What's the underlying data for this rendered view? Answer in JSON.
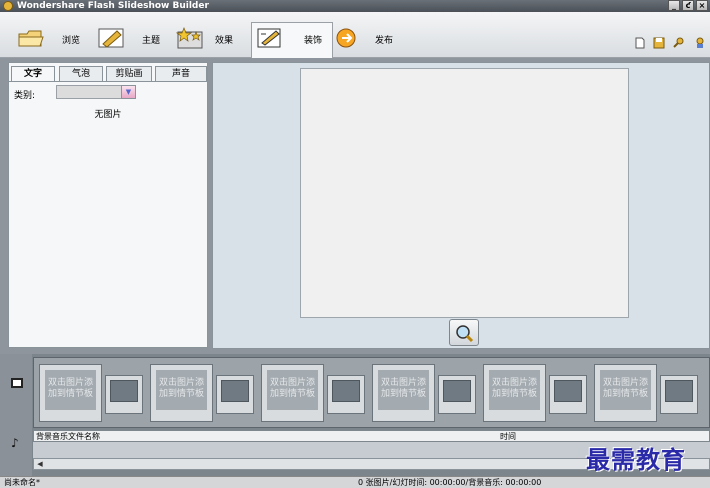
{
  "window": {
    "title": "Wondershare  Flash Slideshow Builder",
    "buttons": [
      "_",
      "ƈ",
      "×"
    ]
  },
  "toolbar": {
    "items": [
      {
        "label": "浏览",
        "icon": "folder-open-icon"
      },
      {
        "label": "主题",
        "icon": "theme-icon"
      },
      {
        "label": "效果",
        "icon": "effects-icon"
      },
      {
        "label": "装饰",
        "icon": "decorate-icon",
        "active": true
      },
      {
        "label": "发布",
        "icon": "publish-icon"
      }
    ],
    "right_icons": [
      "new-icon",
      "save-icon",
      "settings-icon",
      "help-icon"
    ]
  },
  "decorate_panel": {
    "tabs": [
      "文字",
      "气泡",
      "剪贴画",
      "声音"
    ],
    "category_label": "类别:",
    "category_value": "",
    "empty_text": "无图片"
  },
  "storyboard": {
    "placeholder_text": "双击图片添加到情节板",
    "slot_count": 6
  },
  "music": {
    "col_name": "背景音乐文件名称",
    "col_time": "时间"
  },
  "status": {
    "left": "尚未命名*",
    "center": "0 张图片/幻灯时间: 00:00:00/背景音乐: 00:00:00"
  },
  "watermark": "最需教育",
  "colors": {
    "accent": "#e5b43a",
    "preview_bg": "#d8e0e8"
  }
}
